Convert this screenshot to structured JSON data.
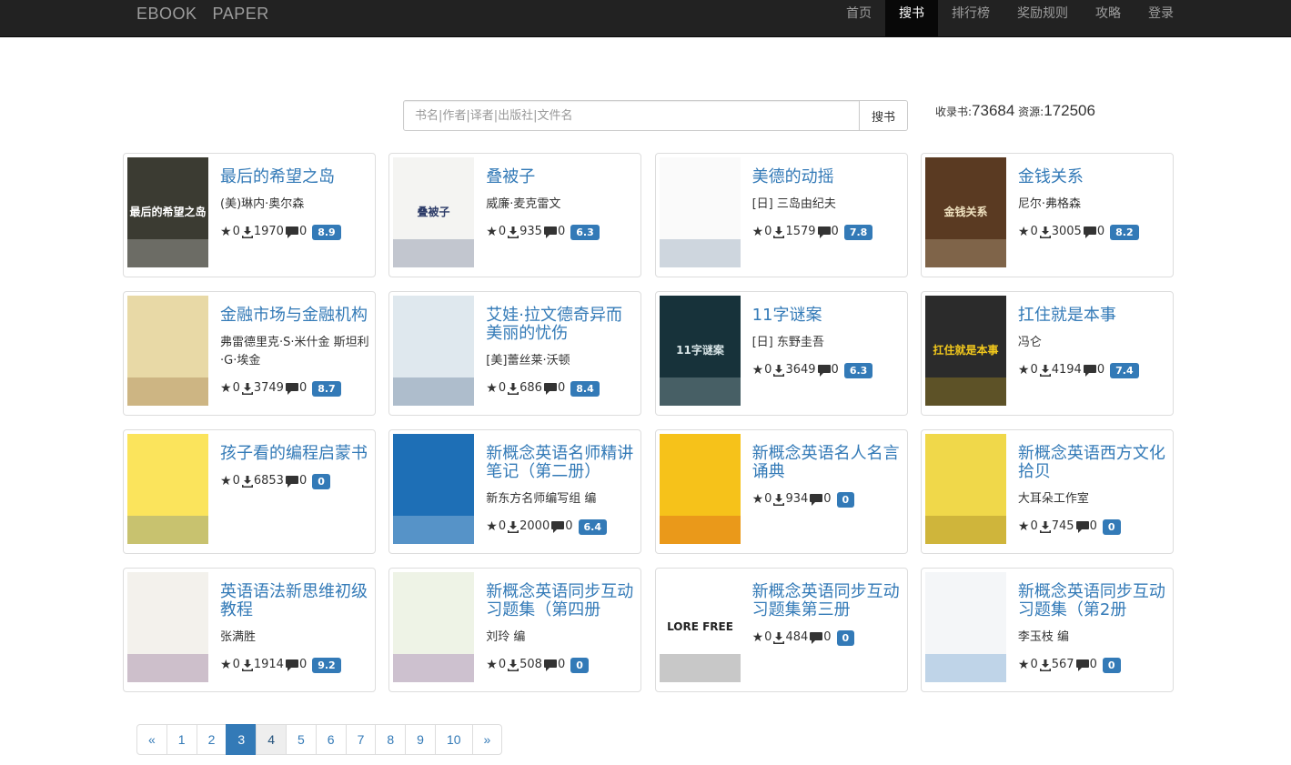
{
  "navbar": {
    "brand": [
      "EBOOK",
      "PAPER"
    ],
    "items": [
      "首页",
      "搜书",
      "排行榜",
      "奖励规则",
      "攻略",
      "登录"
    ],
    "active_index": 1
  },
  "search": {
    "placeholder": "书名|作者|译者|出版社|文件名",
    "button": "搜书"
  },
  "stats": {
    "books_label": "收录书:",
    "books": "73684",
    "resources_label": "资源:",
    "resources": "172506"
  },
  "books": [
    {
      "title": "最后的希望之岛",
      "author": "(美)琳内·奥尔森",
      "stars": "0",
      "downloads": "1970",
      "comments": "0",
      "score": "8.9",
      "cover_text": "最后的希望之岛",
      "cover_bg": "#3b3b32",
      "cover_fg": "#ffffff"
    },
    {
      "title": "叠被子",
      "author": "威廉·麦克雷文",
      "stars": "0",
      "downloads": "935",
      "comments": "0",
      "score": "6.3",
      "cover_text": "叠被子",
      "cover_bg": "#f4f4f2",
      "cover_fg": "#2b3a67"
    },
    {
      "title": "美德的动摇",
      "author": "[日] 三岛由纪夫",
      "stars": "0",
      "downloads": "1579",
      "comments": "0",
      "score": "7.8",
      "cover_text": "",
      "cover_bg": "#fafafa",
      "cover_fg": "#4a6d8c"
    },
    {
      "title": "金钱关系",
      "author": "尼尔·弗格森",
      "stars": "0",
      "downloads": "3005",
      "comments": "0",
      "score": "8.2",
      "cover_text": "金钱关系",
      "cover_bg": "#5a3a22",
      "cover_fg": "#f0e2c0"
    },
    {
      "title": "金融市场与金融机构",
      "author": "弗雷德里克·S·米什金 斯坦利·G·埃金",
      "stars": "0",
      "downloads": "3749",
      "comments": "0",
      "score": "8.7",
      "cover_text": "",
      "cover_bg": "#e8d9a6",
      "cover_fg": "#7a4a1c"
    },
    {
      "title": "艾娃·拉文德奇异而美丽的忧伤",
      "author": "[美]蕾丝莱·沃顿",
      "stars": "0",
      "downloads": "686",
      "comments": "0",
      "score": "8.4",
      "cover_text": "",
      "cover_bg": "#dfe8ee",
      "cover_fg": "#1d3a66"
    },
    {
      "title": "11字谜案",
      "author": "[日] 东野圭吾",
      "stars": "0",
      "downloads": "3649",
      "comments": "0",
      "score": "6.3",
      "cover_text": "11字谜案",
      "cover_bg": "#17323a",
      "cover_fg": "#d9e6e8"
    },
    {
      "title": "扛住就是本事",
      "author": "冯仑",
      "stars": "0",
      "downloads": "4194",
      "comments": "0",
      "score": "7.4",
      "cover_text": "扛住就是本事",
      "cover_bg": "#2b2b2b",
      "cover_fg": "#f2c81c"
    },
    {
      "title": "孩子看的编程启蒙书",
      "author": "",
      "stars": "0",
      "downloads": "6853",
      "comments": "0",
      "score": "0",
      "cover_text": "",
      "cover_bg": "#fbe45c",
      "cover_fg": "#2e5aa8"
    },
    {
      "title": "新概念英语名师精讲笔记（第二册）",
      "author": "新东方名师编写组 编",
      "stars": "0",
      "downloads": "2000",
      "comments": "0",
      "score": "6.4",
      "cover_text": "",
      "cover_bg": "#1e6fb6",
      "cover_fg": "#ffffff"
    },
    {
      "title": "新概念英语名人名言诵典",
      "author": "",
      "stars": "0",
      "downloads": "934",
      "comments": "0",
      "score": "0",
      "cover_text": "",
      "cover_bg": "#f6c21a",
      "cover_fg": "#c9201d"
    },
    {
      "title": "新概念英语西方文化拾贝",
      "author": "大耳朵工作室",
      "stars": "0",
      "downloads": "745",
      "comments": "0",
      "score": "0",
      "cover_text": "",
      "cover_bg": "#f0d84a",
      "cover_fg": "#6b4a10"
    },
    {
      "title": "英语语法新思维初级教程",
      "author": "张满胜",
      "stars": "0",
      "downloads": "1914",
      "comments": "0",
      "score": "9.2",
      "cover_text": "",
      "cover_bg": "#f3f1ec",
      "cover_fg": "#5b2a66"
    },
    {
      "title": "新概念英语同步互动习题集（第四册",
      "author": "刘玲 编",
      "stars": "0",
      "downloads": "508",
      "comments": "0",
      "score": "0",
      "cover_text": "",
      "cover_bg": "#eef3e6",
      "cover_fg": "#6a2a8c"
    },
    {
      "title": "新概念英语同步互动习题集第三册",
      "author": "",
      "stars": "0",
      "downloads": "484",
      "comments": "0",
      "score": "0",
      "cover_text": "LORE FREE",
      "cover_bg": "#ffffff",
      "cover_fg": "#222222"
    },
    {
      "title": "新概念英语同步互动习题集（第2册",
      "author": "李玉枝 编",
      "stars": "0",
      "downloads": "567",
      "comments": "0",
      "score": "0",
      "cover_text": "",
      "cover_bg": "#f4f6f8",
      "cover_fg": "#1e6fb6"
    }
  ],
  "pagination": {
    "prev": "«",
    "pages": [
      "1",
      "2",
      "3",
      "4",
      "5",
      "6",
      "7",
      "8",
      "9",
      "10"
    ],
    "next": "»",
    "current": "3",
    "hovered": "4"
  }
}
